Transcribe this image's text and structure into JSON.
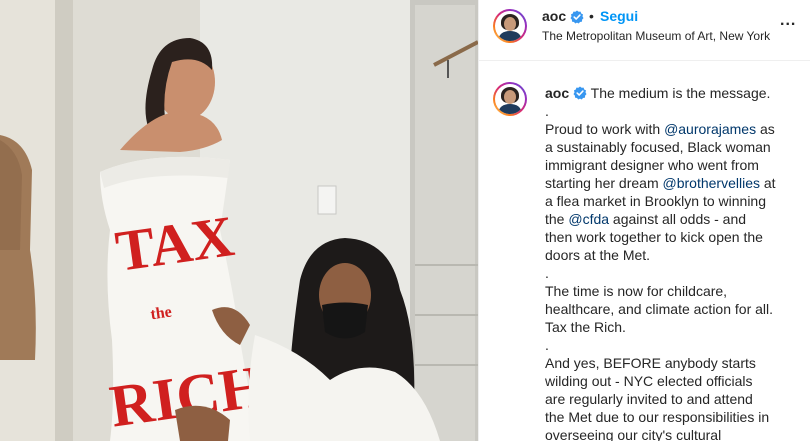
{
  "post": {
    "username": "aoc",
    "follow_label": "Segui",
    "separator": "•",
    "location": "The Metropolitan Museum of Art, New York",
    "more_label": "...",
    "photo_text": [
      "TAX",
      "the",
      "RICH"
    ],
    "caption": {
      "lines": [
        {
          "parts": [
            {
              "t": "The medium is the message."
            }
          ]
        },
        {
          "parts": [
            {
              "t": "."
            }
          ]
        },
        {
          "parts": [
            {
              "t": "Proud to work with "
            },
            {
              "t": "@aurorajames",
              "m": true
            },
            {
              "t": " as"
            }
          ]
        },
        {
          "parts": [
            {
              "t": "a sustainably focused, Black woman"
            }
          ]
        },
        {
          "parts": [
            {
              "t": "immigrant designer who went from"
            }
          ]
        },
        {
          "parts": [
            {
              "t": "starting her dream "
            },
            {
              "t": "@brothervellies",
              "m": true
            },
            {
              "t": " at"
            }
          ]
        },
        {
          "parts": [
            {
              "t": "a flea market in Brooklyn to winning"
            }
          ]
        },
        {
          "parts": [
            {
              "t": "the "
            },
            {
              "t": "@cfda",
              "m": true
            },
            {
              "t": " against all odds - and"
            }
          ]
        },
        {
          "parts": [
            {
              "t": "then work together to kick open the"
            }
          ]
        },
        {
          "parts": [
            {
              "t": "doors at the Met."
            }
          ]
        },
        {
          "parts": [
            {
              "t": "."
            }
          ]
        },
        {
          "parts": [
            {
              "t": "The time is now for childcare,"
            }
          ]
        },
        {
          "parts": [
            {
              "t": "healthcare, and climate action for all."
            }
          ]
        },
        {
          "parts": [
            {
              "t": "Tax the Rich."
            }
          ]
        },
        {
          "parts": [
            {
              "t": "."
            }
          ]
        },
        {
          "parts": [
            {
              "t": "And yes, BEFORE anybody starts"
            }
          ]
        },
        {
          "parts": [
            {
              "t": "wilding out - NYC elected officials"
            }
          ]
        },
        {
          "parts": [
            {
              "t": "are regularly invited to and attend"
            }
          ]
        },
        {
          "parts": [
            {
              "t": "the Met due to our responsibilities in"
            }
          ]
        },
        {
          "parts": [
            {
              "t": "overseeing our city's cultural"
            }
          ]
        }
      ]
    },
    "colors": {
      "accent": "#0095f6",
      "mention": "#00376b",
      "verified": "#3897f0",
      "dress_text": "#d0201f"
    }
  }
}
